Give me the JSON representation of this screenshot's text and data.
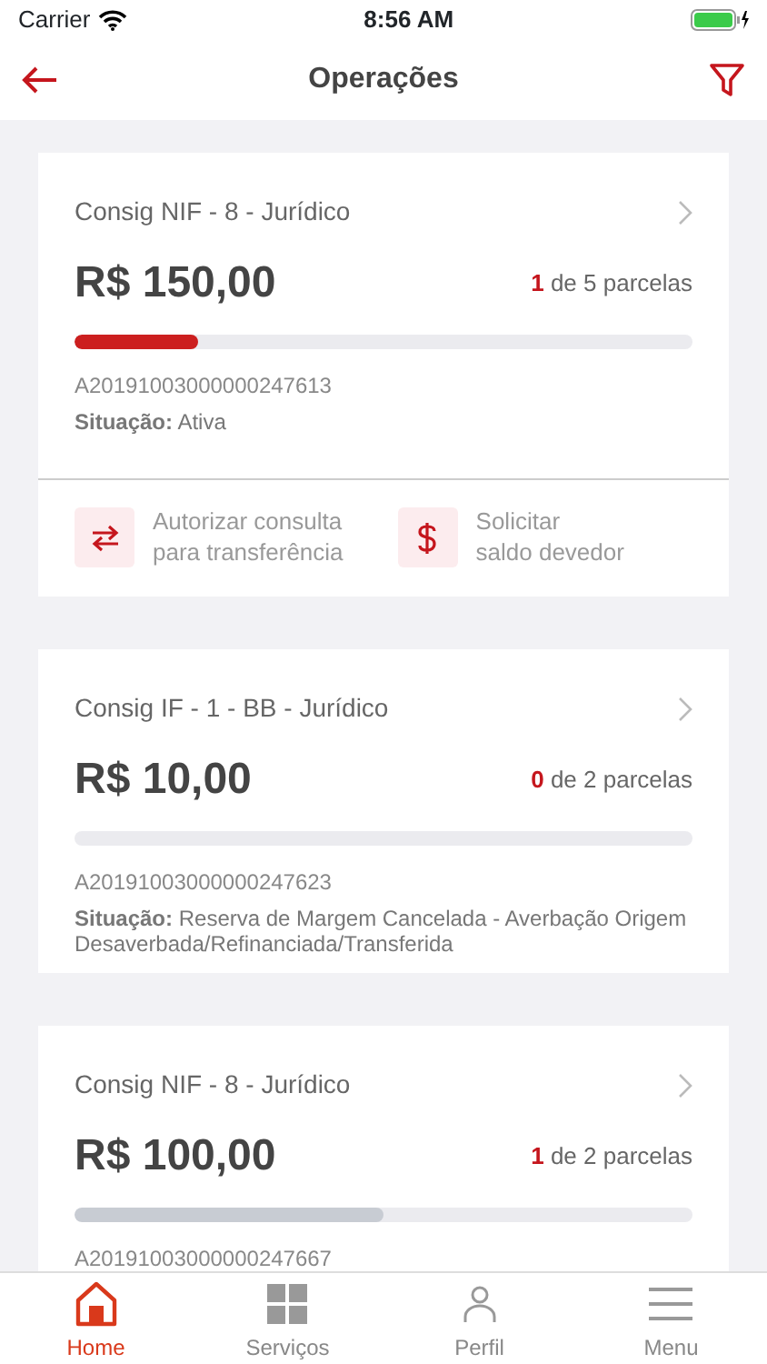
{
  "status_bar": {
    "carrier": "Carrier",
    "time": "8:56 AM"
  },
  "nav": {
    "title": "Operações"
  },
  "operations": [
    {
      "name": "Consig NIF - 8 - Jurídico",
      "amount": "R$ 150,00",
      "paid": "1",
      "of_total": "de 5 parcelas",
      "level": 0.2,
      "color": "#cc1f1f",
      "code": "A20191003000000247613",
      "situation": "**Situação:** Ativa",
      "actions": [
        {
          "kind": "transfer",
          "label": "Autorizar consulta\npara transferência"
        },
        {
          "kind": "dollar",
          "label": "Solicitar\nsaldo devedor"
        }
      ]
    },
    {
      "name": "Consig IF - 1 - BB - Jurídico",
      "amount": "R$ 10,00",
      "paid": "0",
      "of_total": "de 2 parcelas",
      "code": "A20191003000000247623",
      "situation": "**Situação:** Reserva de Margem Cancelada - Averbação Origem Desaverbada/Refinanciada/Transferida"
    },
    {
      "name": "Consig NIF - 8 - Jurídico",
      "amount": "R$ 100,00",
      "paid": "1",
      "of_total": "de 2 parcelas",
      "level": 0.5,
      "color": "#c8ccd3",
      "code": "A20191003000000247667"
    }
  ],
  "tabs": [
    {
      "kind": "home",
      "label": "Home",
      "selected": true
    },
    {
      "kind": "grid",
      "label": "Serviços",
      "selected": false
    },
    {
      "kind": "person",
      "label": "Perfil",
      "selected": false
    },
    {
      "kind": "menu",
      "label": "Menu",
      "selected": false
    }
  ]
}
